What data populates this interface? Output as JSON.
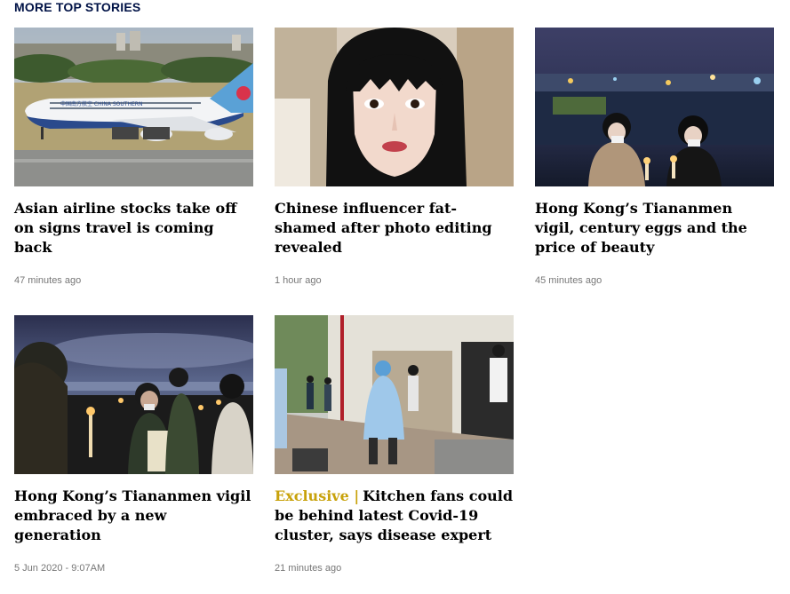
{
  "section": {
    "title": "MORE TOP STORIES"
  },
  "stories": [
    {
      "headline": "Asian airline stocks take off on signs travel is coming back",
      "timestamp": "47 minutes ago",
      "image_caption_text": "中国南方航空 CHINA SOUTHERN"
    },
    {
      "headline": "Chinese influencer fat-shamed after photo editing revealed",
      "timestamp": "1 hour ago"
    },
    {
      "headline": "Hong Kong’s Tiananmen vigil, century eggs and the price of beauty",
      "timestamp": "45 minutes ago"
    },
    {
      "headline": "Hong Kong’s Tiananmen vigil embraced by a new generation",
      "timestamp": "5 Jun 2020 - 9:07AM"
    },
    {
      "kicker": "Exclusive",
      "kicker_separator": "|",
      "headline": "Kitchen fans could be behind latest Covid-19 cluster, says disease expert",
      "timestamp": "21 minutes ago"
    }
  ],
  "colors": {
    "section_title": "#001246",
    "kicker": "#c8a20b",
    "timestamp": "#777777"
  }
}
